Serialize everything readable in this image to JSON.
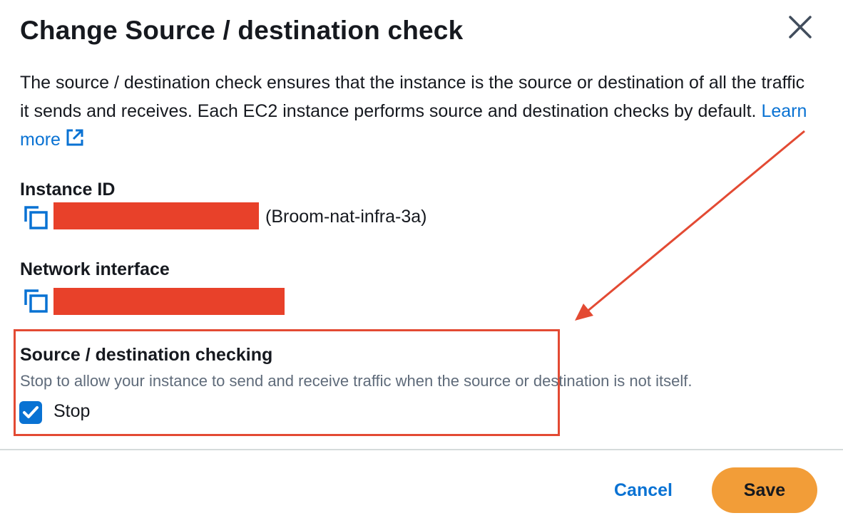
{
  "dialog": {
    "title": "Change Source / destination check",
    "description": "The source / destination check ensures that the instance is the source or destination of all the traffic it sends and receives. Each EC2 instance performs source and destination checks by default.",
    "learn_more": "Learn more"
  },
  "instance_id": {
    "label": "Instance ID",
    "name": "(Broom-nat-infra-3a)"
  },
  "network_interface": {
    "label": "Network interface"
  },
  "source_dest_check": {
    "label": "Source / destination checking",
    "description": "Stop to allow your instance to send and receive traffic when the source or destination is not itself.",
    "checkbox_label": "Stop",
    "checked": true
  },
  "footer": {
    "cancel_label": "Cancel",
    "save_label": "Save"
  },
  "colors": {
    "accent": "#0972d3",
    "primary_button": "#f29d38",
    "annotation": "#e34a33",
    "redaction": "#e8412a"
  },
  "icons": [
    "close-icon",
    "external-link-icon",
    "copy-icon",
    "check-icon"
  ]
}
